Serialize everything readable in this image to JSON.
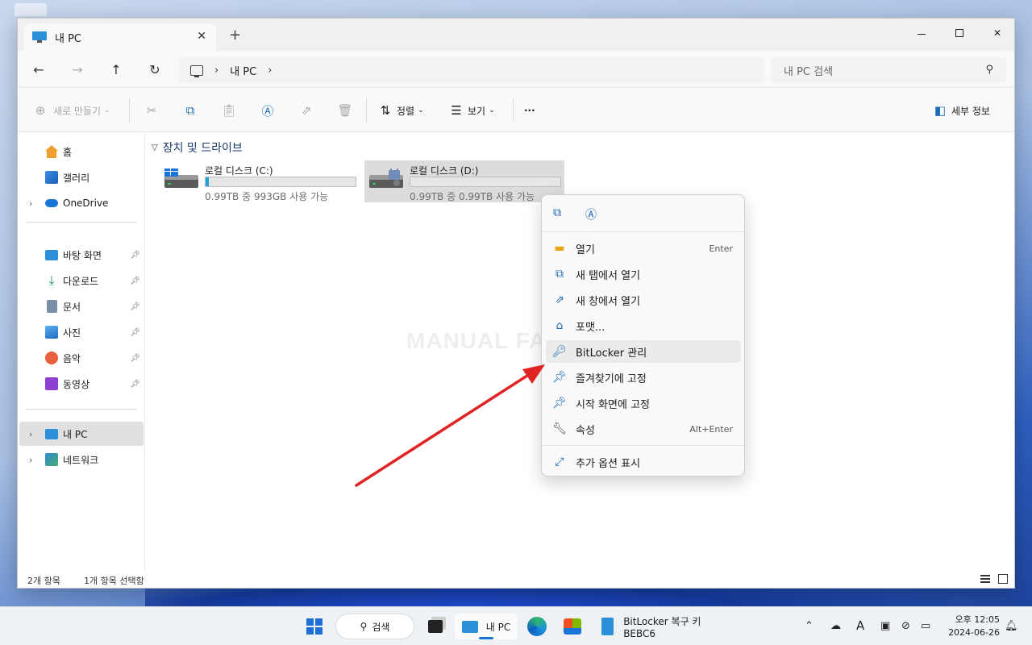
{
  "window": {
    "tab_title": "내 PC",
    "tab_close": "✕",
    "new_tab": "+",
    "minimize": "",
    "maximize": "",
    "close": "✕"
  },
  "address": {
    "path": [
      "내 PC"
    ],
    "search_placeholder": "내 PC 검색"
  },
  "toolbar": {
    "new_label": "새로 만들기",
    "sort_label": "정렬",
    "view_label": "보기",
    "more_label": "···",
    "details_label": "세부 정보"
  },
  "sidebar": {
    "top_items": [
      {
        "label": "홈",
        "icon": "home-icon"
      },
      {
        "label": "갤러리",
        "icon": "gallery-icon"
      },
      {
        "label": "OneDrive",
        "icon": "onedrive-icon"
      }
    ],
    "pinned_items": [
      {
        "label": "바탕 화면",
        "icon": "desktop-icon"
      },
      {
        "label": "다운로드",
        "icon": "download-icon"
      },
      {
        "label": "문서",
        "icon": "documents-icon"
      },
      {
        "label": "사진",
        "icon": "pictures-icon"
      },
      {
        "label": "음악",
        "icon": "music-icon"
      },
      {
        "label": "동영상",
        "icon": "videos-icon"
      }
    ],
    "bottom_items": [
      {
        "label": "내 PC",
        "icon": "pc-icon",
        "selected": true
      },
      {
        "label": "네트워크",
        "icon": "network-icon"
      }
    ]
  },
  "content": {
    "group_title": "장치 및 드라이브",
    "drives": [
      {
        "name": "로컬 디스크 (C:)",
        "info": "0.99TB 중 993GB 사용 가능",
        "used_fraction": 0.02,
        "locked": false
      },
      {
        "name": "로컬 디스크 (D:)",
        "info": "0.99TB 중 0.99TB 사용 가능",
        "used_fraction": 0.0,
        "locked": true
      }
    ],
    "watermark": "MANUAL FACTORY"
  },
  "context_menu": {
    "items": [
      {
        "label": "열기",
        "shortcut": "Enter",
        "icon": "folder-open-icon"
      },
      {
        "label": "새 탭에서 열기",
        "shortcut": "",
        "icon": "open-new-tab-icon"
      },
      {
        "label": "새 창에서 열기",
        "shortcut": "",
        "icon": "open-new-window-icon"
      },
      {
        "label": "포맷...",
        "shortcut": "",
        "icon": "format-icon"
      },
      {
        "label": "BitLocker 관리",
        "shortcut": "",
        "icon": "bitlocker-icon"
      },
      {
        "label": "즐겨찾기에 고정",
        "shortcut": "",
        "icon": "pin-icon"
      },
      {
        "label": "시작 화면에 고정",
        "shortcut": "",
        "icon": "pin-start-icon"
      },
      {
        "label": "속성",
        "shortcut": "Alt+Enter",
        "icon": "properties-icon"
      },
      {
        "label": "추가 옵션 표시",
        "shortcut": "",
        "icon": "more-options-icon"
      }
    ]
  },
  "statusbar": {
    "item_count": "2개 항목",
    "selected_count": "1개 항목 선택함"
  },
  "taskbar": {
    "search_label": "검색",
    "explorer_label": "내 PC",
    "notepad_label": "BitLocker 복구 키 BEBC6",
    "time": "오후 12:05",
    "date": "2024-06-26",
    "ime": "A"
  },
  "colors": {
    "accent": "#1a73d8",
    "arrow": "#e02424",
    "drive_fill": "#26a0da"
  }
}
